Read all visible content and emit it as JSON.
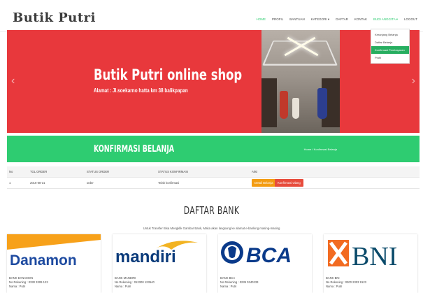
{
  "brand": "Butik Putri",
  "nav": {
    "items": [
      "HOME",
      "PROFIL",
      "BANTUAN",
      "KATEGORI ▾",
      "DAFTAR",
      "KONTAK",
      "BUDI ANGGITA ▾",
      "LOGOUT"
    ],
    "dropdown": [
      "Keranjang Belanja",
      "Daftar Belanja",
      "Konfirmasi Pembayaran",
      "Profil"
    ]
  },
  "hero": {
    "title": "Butik Putri online shop",
    "subtitle": "Alamat : Jl.soekarno hatta km 38 balikpapan",
    "prev": "‹",
    "next": "›"
  },
  "band": {
    "title": "KONFIRMASI BELANJA",
    "breadcrumb": "Home / Konfirmasi Belanja"
  },
  "table": {
    "headers": [
      "No",
      "TGL ORDER",
      "STATUS ORDER",
      "STATUS KONFIRMASI",
      "Aksi"
    ],
    "rows": [
      {
        "no": "1",
        "date": "2016-08-31",
        "status": "order",
        "confirm": "Telah konfirmasi",
        "btn1": "Detail Belanja",
        "btn2": "Konfirmasi Ulang"
      }
    ]
  },
  "banks": {
    "title": "DAFTAR BANK",
    "note": "Untuk Transfer Bisa Mengklik Gambar Bank, Maka akan langsung ke alamat e-banking masing-masing",
    "cards": [
      {
        "logo": "Danamon",
        "name": "BANK DANAMON",
        "rek": "No Rekening : 0330 3309 123",
        "owner": "Nama : Putri"
      },
      {
        "logo": "mandiri",
        "name": "BANK MANDIRI",
        "rek": "No Rekening : 012300 123540",
        "owner": "Nama : Putri"
      },
      {
        "logo": "BCA",
        "name": "BANK BCA",
        "rek": "No Rekening : 0239 0340233",
        "owner": "Nama : Putri"
      },
      {
        "logo": "BNI",
        "name": "BANK BNI",
        "rek": "No Rekening : 0300 2303 9123",
        "owner": "Nama : Putri"
      }
    ]
  },
  "colors": {
    "red": "#e8383c",
    "green": "#2ecc71",
    "orange": "#f39c12",
    "danger": "#e74c3c"
  }
}
